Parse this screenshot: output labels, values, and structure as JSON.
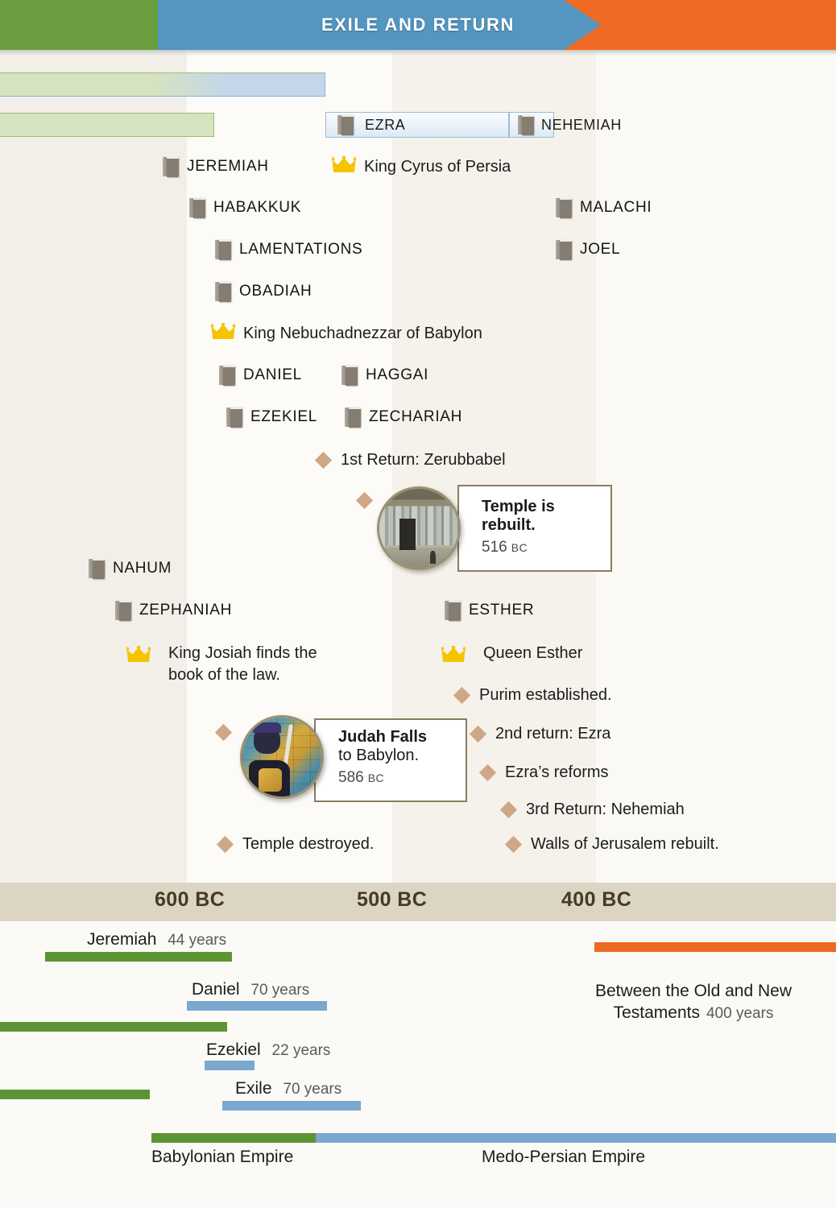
{
  "banner": {
    "title": "EXILE AND RETURN",
    "segments": [
      {
        "name": "judah-era",
        "color": "#6a9e3e"
      },
      {
        "name": "exile-era",
        "color": "#5496c0"
      },
      {
        "name": "return-era",
        "color": "#ef6b25"
      }
    ]
  },
  "nav": {
    "ezra": "EZRA",
    "nehemiah": "NEHEMIAH"
  },
  "entries": [
    {
      "id": "jeremiah",
      "icon": "book-icon",
      "label": "JEREMIAH",
      "style": "caps"
    },
    {
      "id": "king-cyrus",
      "icon": "crown-icon",
      "label": "King Cyrus of Persia",
      "style": "reg"
    },
    {
      "id": "habakkuk",
      "icon": "book-icon",
      "label": "HABAKKUK",
      "style": "caps"
    },
    {
      "id": "malachi",
      "icon": "book-icon",
      "label": "MALACHI",
      "style": "caps"
    },
    {
      "id": "lamentations",
      "icon": "book-icon",
      "label": "LAMENTATIONS",
      "style": "caps"
    },
    {
      "id": "joel",
      "icon": "book-icon",
      "label": "JOEL",
      "style": "caps"
    },
    {
      "id": "obadiah",
      "icon": "book-icon",
      "label": "OBADIAH",
      "style": "caps"
    },
    {
      "id": "king-nebuchadnezzar",
      "icon": "crown-icon",
      "label": "King Nebuchadnezzar of Babylon",
      "style": "reg"
    },
    {
      "id": "daniel",
      "icon": "book-icon",
      "label": "DANIEL",
      "style": "caps"
    },
    {
      "id": "haggai",
      "icon": "book-icon",
      "label": "HAGGAI",
      "style": "caps"
    },
    {
      "id": "ezekiel",
      "icon": "book-icon",
      "label": "EZEKIEL",
      "style": "caps"
    },
    {
      "id": "zechariah",
      "icon": "book-icon",
      "label": "ZECHARIAH",
      "style": "caps"
    },
    {
      "id": "first-return",
      "icon": "diamond-icon",
      "label": "1st Return: Zerubbabel",
      "style": "reg"
    },
    {
      "id": "nahum",
      "icon": "book-icon",
      "label": "NAHUM",
      "style": "caps"
    },
    {
      "id": "zephaniah",
      "icon": "book-icon",
      "label": "ZEPHANIAH",
      "style": "caps"
    },
    {
      "id": "esther-book",
      "icon": "book-icon",
      "label": "ESTHER",
      "style": "caps"
    },
    {
      "id": "king-josiah",
      "icon": "crown-icon",
      "label": "King Josiah finds the\nbook of the law.",
      "style": "reg"
    },
    {
      "id": "queen-esther",
      "icon": "crown-icon",
      "label": "Queen Esther",
      "style": "reg"
    },
    {
      "id": "purim",
      "icon": "diamond-icon",
      "label": "Purim established.",
      "style": "reg"
    },
    {
      "id": "second-return",
      "icon": "diamond-icon",
      "label": "2nd return: Ezra",
      "style": "reg"
    },
    {
      "id": "ezra-reforms",
      "icon": "diamond-icon",
      "label": "Ezra’s reforms",
      "style": "reg"
    },
    {
      "id": "third-return",
      "icon": "diamond-icon",
      "label": "3rd Return: Nehemiah",
      "style": "reg"
    },
    {
      "id": "temple-destroyed",
      "icon": "diamond-icon",
      "label": "Temple destroyed.",
      "style": "reg"
    },
    {
      "id": "walls-rebuilt",
      "icon": "diamond-icon",
      "label": "Walls of Jerusalem rebuilt.",
      "style": "reg"
    }
  ],
  "callouts": [
    {
      "id": "temple-rebuilt",
      "image": "temple-photo",
      "bold": "Temple is",
      "bold2": "rebuilt.",
      "regular": "",
      "year": "516",
      "era": "BC"
    },
    {
      "id": "judah-falls",
      "image": "babylon-mosaic-photo",
      "bold": "Judah Falls",
      "bold2": "",
      "regular": "to Babylon.",
      "year": "586",
      "era": "BC"
    }
  ],
  "axis": {
    "ticks": [
      "600 BC",
      "500 BC",
      "400 BC"
    ],
    "band_color": "#dcd5c3"
  },
  "chart_data": {
    "type": "bar",
    "title": "Exile and Return timeline durations",
    "xlabel": "",
    "ylabel": "",
    "axis_ticks": [
      "600 BC",
      "500 BC",
      "400 BC"
    ],
    "bars": [
      {
        "name": "Jeremiah",
        "duration": "44 years",
        "years": 44,
        "color": "#5d9434",
        "label": "Jeremiah",
        "value_text": "44 years"
      },
      {
        "name": "Daniel",
        "duration": "70 years",
        "years": 70,
        "color": "#7aa8cf",
        "label": "Daniel",
        "value_text": "70 years"
      },
      {
        "name": "Ezekiel",
        "duration": "22 years",
        "years": 22,
        "color": "#7aa8cf",
        "label": "Ezekiel",
        "value_text": "22 years"
      },
      {
        "name": "Exile",
        "duration": "70 years",
        "years": 70,
        "color": "#7aa8cf",
        "label": "Exile",
        "value_text": "70 years"
      },
      {
        "name": "Between the Old and New Testaments",
        "duration": "400 years",
        "years": 400,
        "color": "#ec6a21",
        "label": "Between the Old and New\nTestaments",
        "value_text": "400 years"
      }
    ],
    "empires": [
      {
        "name": "Babylonian Empire",
        "color": "#5d9434"
      },
      {
        "name": "Medo-Persian Empire",
        "color": "#7aa8cf"
      }
    ]
  },
  "gantt": {
    "jeremiah_label": "Jeremiah",
    "jeremiah_years": "44 years",
    "daniel_label": "Daniel",
    "daniel_years": "70 years",
    "ezekiel_label": "Ezekiel",
    "ezekiel_years": "22 years",
    "exile_label": "Exile",
    "exile_years": "70 years",
    "between_label": "Between the Old and New\nTestaments",
    "between_years": "400 years",
    "babylonian": "Babylonian Empire",
    "medo_persian": "Medo-Persian Empire"
  }
}
